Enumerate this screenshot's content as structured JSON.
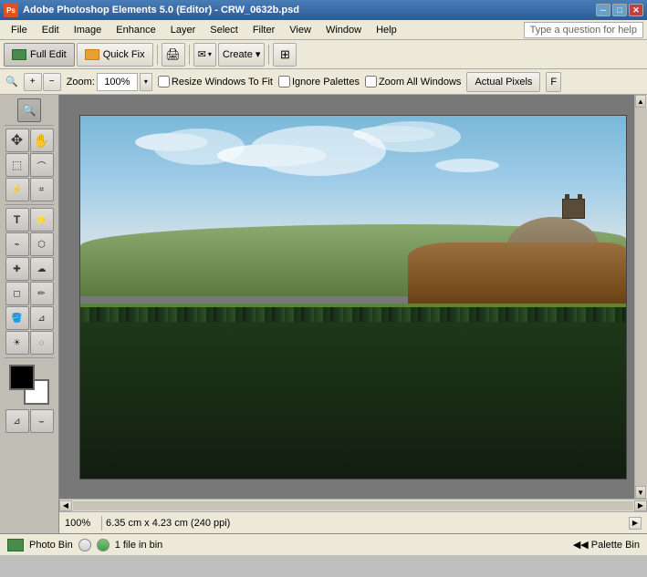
{
  "titlebar": {
    "app_name": "Adobe Photoshop Elements 5.0 (Editor) - CRW_0632b.psd",
    "icon_label": "PS",
    "minimize": "─",
    "maximize": "□",
    "close": "✕",
    "inner_min": "─",
    "inner_max": "□",
    "inner_close": "✕"
  },
  "menubar": {
    "items": [
      "File",
      "Edit",
      "Image",
      "Enhance",
      "Layer",
      "Select",
      "Filter",
      "View",
      "Window",
      "Help"
    ],
    "help_placeholder": "Type a question for help"
  },
  "toolbar1": {
    "full_edit": "Full Edit",
    "quick_fix": "Quick Fix",
    "print_label": "🖨",
    "email_label": "✉",
    "create_label": "Create ▾",
    "grid_label": "⊞"
  },
  "optionsbar": {
    "zoom_label": "Zoom:",
    "zoom_value": "100%",
    "resize_windows": "Resize Windows To Fit",
    "ignore_palettes": "Ignore Palettes",
    "zoom_all_windows": "Zoom All Windows",
    "actual_pixels": "Actual Pixels",
    "fit_btn": "F"
  },
  "tools": [
    {
      "name": "zoom-tool",
      "icon": "🔍"
    },
    {
      "name": "move-tool",
      "icon": "✥"
    },
    {
      "name": "hand-tool",
      "icon": "✋"
    },
    {
      "name": "marquee-tool",
      "icon": "⬚"
    },
    {
      "name": "lasso-tool",
      "icon": "⌒"
    },
    {
      "name": "magic-wand-tool",
      "icon": "⚡"
    },
    {
      "name": "crop-tool",
      "icon": "⌗"
    },
    {
      "name": "type-tool",
      "icon": "T"
    },
    {
      "name": "brush-tool",
      "icon": "⌁"
    },
    {
      "name": "shape-tool",
      "icon": "⬡"
    },
    {
      "name": "heal-tool",
      "icon": "✚"
    },
    {
      "name": "clone-tool",
      "icon": "☁"
    },
    {
      "name": "eraser-tool",
      "icon": "◻"
    },
    {
      "name": "pencil-tool",
      "icon": "✏"
    },
    {
      "name": "paint-bucket-tool",
      "icon": "🪣"
    },
    {
      "name": "dodge-tool",
      "icon": "☀"
    },
    {
      "name": "blur-tool",
      "icon": "◌"
    },
    {
      "name": "eyedropper-tool",
      "icon": "⊿"
    },
    {
      "name": "smudge-tool",
      "icon": "⌣"
    }
  ],
  "statusbar": {
    "zoom": "100%",
    "dimensions": "6.35 cm x 4.23 cm (240 ppi)"
  },
  "bottombar": {
    "photo_bin": "Photo Bin",
    "files_count": "1 file in bin",
    "palette_bin": "◀◀ Palette Bin"
  }
}
